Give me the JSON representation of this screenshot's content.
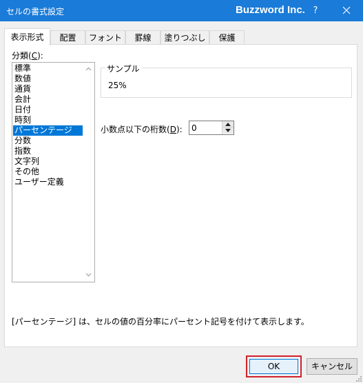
{
  "titlebar": {
    "title": "セルの書式設定",
    "brand": "Buzzword Inc.",
    "help": "?"
  },
  "tabs": [
    {
      "label": "表示形式",
      "active": true
    },
    {
      "label": "配置",
      "active": false
    },
    {
      "label": "フォント",
      "active": false
    },
    {
      "label": "罫線",
      "active": false
    },
    {
      "label": "塗りつぶし",
      "active": false
    },
    {
      "label": "保護",
      "active": false
    }
  ],
  "category": {
    "label_pre": "分類(",
    "label_key": "C",
    "label_post": "):",
    "items": [
      "標準",
      "数値",
      "通貨",
      "会計",
      "日付",
      "時刻",
      "パーセンテージ",
      "分数",
      "指数",
      "文字列",
      "その他",
      "ユーザー定義"
    ],
    "selected": "パーセンテージ"
  },
  "sample": {
    "legend": "サンプル",
    "value": "25%"
  },
  "decimal": {
    "label_pre": "小数点以下の桁数(",
    "label_key": "D",
    "label_post": "):",
    "value": "0"
  },
  "description": "[パーセンテージ] は、セルの値の百分率にパーセント記号を付けて表示します。",
  "buttons": {
    "ok": "OK",
    "cancel": "キャンセル"
  }
}
